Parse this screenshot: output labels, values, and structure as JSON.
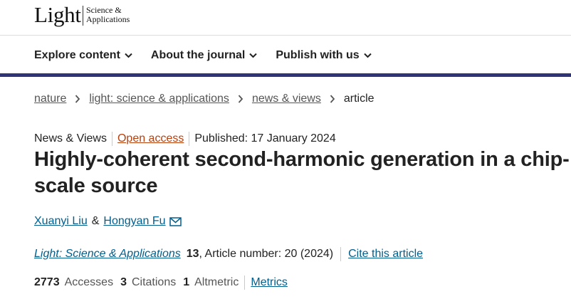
{
  "logo": {
    "main": "Light",
    "sub_line1": "Science &",
    "sub_line2": "Applications"
  },
  "nav": [
    {
      "label": "Explore content"
    },
    {
      "label": "About the journal"
    },
    {
      "label": "Publish with us"
    }
  ],
  "breadcrumb": [
    {
      "label": "nature"
    },
    {
      "label": "light: science & applications"
    },
    {
      "label": "news & views"
    },
    {
      "label": "article"
    }
  ],
  "meta": {
    "type": "News & Views",
    "open_access": "Open access",
    "published": "Published: 17 January 2024"
  },
  "article": {
    "title": "Highly-coherent second-harmonic generation in a chip-scale source"
  },
  "authors": [
    {
      "name": "Xuanyi Liu"
    },
    {
      "name": "Hongyan Fu"
    }
  ],
  "authors_joiner": "&",
  "journal": {
    "name": "Light: Science & Applications",
    "volume": "13",
    "article_number": ", Article number: 20 (2024)",
    "cite_label": "Cite this article"
  },
  "metrics": {
    "accesses_count": "2773",
    "accesses_label": "Accesses",
    "citations_count": "3",
    "citations_label": "Citations",
    "altmetric_count": "1",
    "altmetric_label": "Altmetric",
    "metrics_link": "Metrics"
  },
  "colors": {
    "link": "#025e8d",
    "open_access": "#b7410e",
    "nav_rule": "#2f3477",
    "text": "#222222"
  },
  "icons": {
    "nav_chevron": "chevron-down-icon",
    "crumb_separator": "chevron-right-icon",
    "email": "envelope-icon"
  }
}
